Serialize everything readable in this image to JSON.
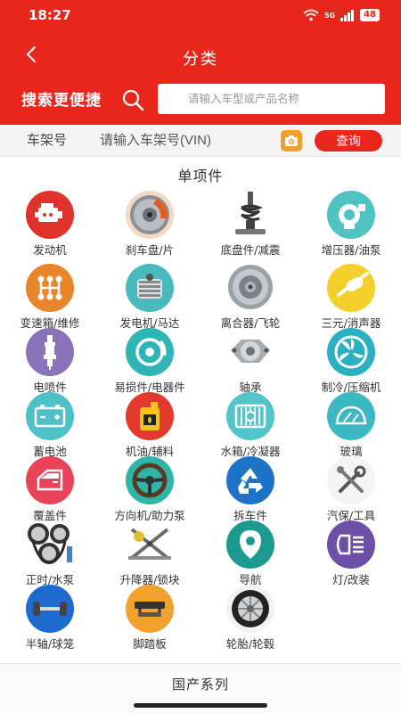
{
  "status_bar": {
    "time": "18:27",
    "network": "5G",
    "battery": "48"
  },
  "nav": {
    "title": "分类"
  },
  "search": {
    "promo": "搜索更便捷",
    "placeholder": "请输入车型或产品名称"
  },
  "vin": {
    "label": "车架号",
    "placeholder": "请输入车架号(VIN)",
    "query_button": "查询"
  },
  "section": {
    "title": "单项件"
  },
  "categories": [
    {
      "label": "发动机",
      "icon": "engine-icon"
    },
    {
      "label": "刹车盘/片",
      "icon": "brake-disc-icon"
    },
    {
      "label": "底盘件/减震",
      "icon": "shock-absorber-icon"
    },
    {
      "label": "增压器/油泵",
      "icon": "turbocharger-icon"
    },
    {
      "label": "变速箱/维修",
      "icon": "gear-shift-icon"
    },
    {
      "label": "发电机/马达",
      "icon": "alternator-icon"
    },
    {
      "label": "离合器/飞轮",
      "icon": "clutch-icon"
    },
    {
      "label": "三元/消声器",
      "icon": "muffler-icon"
    },
    {
      "label": "电喷件",
      "icon": "spark-plug-icon"
    },
    {
      "label": "易损件/电器件",
      "icon": "brake-wear-icon"
    },
    {
      "label": "轴承",
      "icon": "wheel-bearing-icon"
    },
    {
      "label": "制冷/压缩机",
      "icon": "cooling-fan-icon"
    },
    {
      "label": "蓄电池",
      "icon": "battery-icon"
    },
    {
      "label": "机油/辅料",
      "icon": "oil-can-icon"
    },
    {
      "label": "水箱/冷凝器",
      "icon": "radiator-icon"
    },
    {
      "label": "玻璃",
      "icon": "windshield-icon"
    },
    {
      "label": "覆盖件",
      "icon": "car-door-icon"
    },
    {
      "label": "方向机/助力泵",
      "icon": "steering-wheel-icon"
    },
    {
      "label": "拆车件",
      "icon": "recycle-icon"
    },
    {
      "label": "汽保/工具",
      "icon": "wrench-tools-icon"
    },
    {
      "label": "正时/水泵",
      "icon": "timing-kit-icon"
    },
    {
      "label": "升降器/锁块",
      "icon": "window-regulator-icon"
    },
    {
      "label": "导航",
      "icon": "location-pin-icon"
    },
    {
      "label": "灯/改装",
      "icon": "headlight-icon"
    },
    {
      "label": "半轴/球笼",
      "icon": "drive-shaft-icon"
    },
    {
      "label": "脚踏板",
      "icon": "foot-pedal-icon"
    },
    {
      "label": "轮胎/轮毂",
      "icon": "tire-icon"
    }
  ],
  "footer": {
    "title": "国产系列"
  },
  "colors": {
    "brand_red": "#e8261c",
    "accent_orange": "#f0a02a"
  }
}
